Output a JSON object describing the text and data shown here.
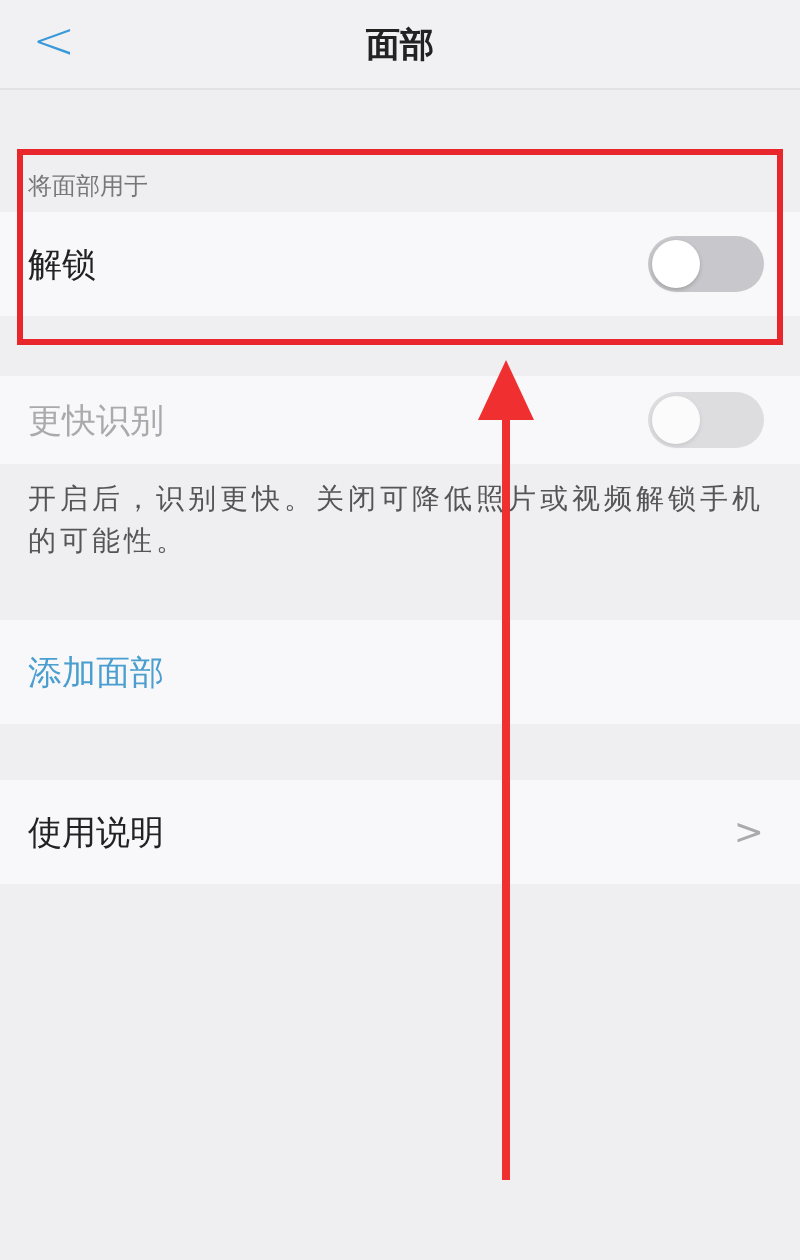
{
  "nav": {
    "back": "<",
    "title": "面部"
  },
  "sections": [
    {
      "header": "将面部用于",
      "items": [
        {
          "kind": "toggle",
          "label": "解锁",
          "on": false,
          "disabled": false
        }
      ]
    },
    {
      "items": [
        {
          "kind": "toggle",
          "label": "更快识别",
          "on": false,
          "disabled": true
        }
      ],
      "note": "开启后，识别更快。关闭可降低照片或视频解锁手机的可能性。"
    },
    {
      "items": [
        {
          "kind": "link",
          "label": "添加面部"
        }
      ]
    },
    {
      "items": [
        {
          "kind": "nav",
          "label": "使用说明",
          "chevron": ">"
        }
      ]
    }
  ]
}
